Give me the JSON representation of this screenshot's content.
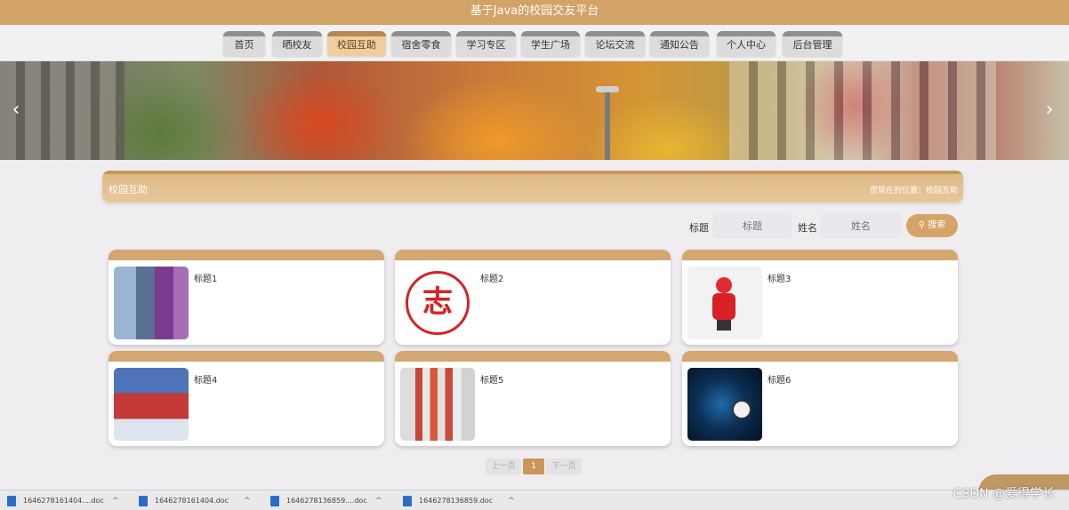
{
  "app": {
    "title": "基于Java的校园交友平台"
  },
  "nav": {
    "items": [
      {
        "label": "首页"
      },
      {
        "label": "晒校友"
      },
      {
        "label": "校园互助"
      },
      {
        "label": "宿舍零食"
      },
      {
        "label": "学习专区"
      },
      {
        "label": "学生广场"
      },
      {
        "label": "论坛交流"
      },
      {
        "label": "通知公告"
      },
      {
        "label": "个人中心"
      },
      {
        "label": "后台管理"
      }
    ],
    "active_index": 2
  },
  "banner": {
    "prev_icon": "chevron-left-icon",
    "next_icon": "chevron-right-icon"
  },
  "section": {
    "title": "校园互助",
    "breadcrumb": "您现在的位置：校园互助"
  },
  "search": {
    "title_label": "标题",
    "title_placeholder": "标题",
    "name_label": "姓名",
    "name_placeholder": "姓名",
    "button_label": "搜索",
    "button_icon": "search-icon"
  },
  "cards": [
    {
      "title": "标题1"
    },
    {
      "title": "标题2"
    },
    {
      "title": "标题3"
    },
    {
      "title": "标题4"
    },
    {
      "title": "标题5"
    },
    {
      "title": "标题6"
    }
  ],
  "pagination": {
    "prev_label": "上一页",
    "current": "1",
    "next_label": "下一页"
  },
  "downloads": [
    {
      "name": "1646278161404....doc"
    },
    {
      "name": "1646278161404.doc"
    },
    {
      "name": "1646278136859....doc"
    },
    {
      "name": "1646278136859.doc"
    }
  ],
  "watermark": "CSDN @爱得学长",
  "colors": {
    "accent": "#d3a266",
    "active_nav": "#f0cd9f",
    "card_top": "#d2a772"
  }
}
